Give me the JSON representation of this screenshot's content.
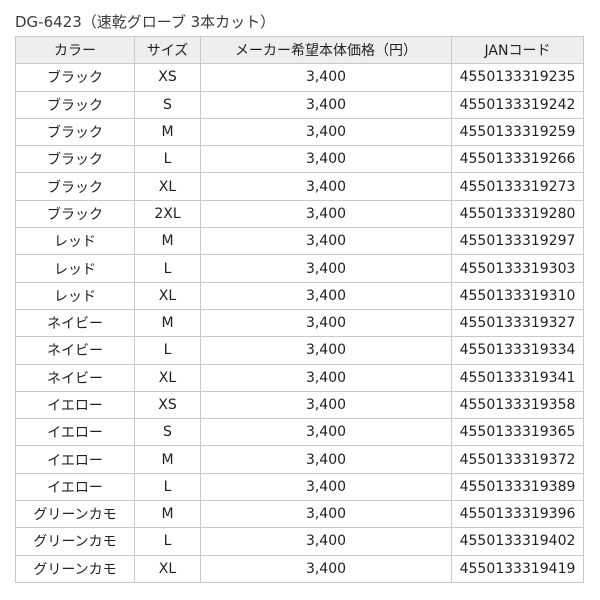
{
  "title": "DG-6423（速乾グローブ 3本カット）",
  "table": {
    "headers": [
      "カラー",
      "サイズ",
      "メーカー希望本体価格（円）",
      "JANコード"
    ],
    "rows": [
      [
        "ブラック",
        "XS",
        "3,400",
        "4550133319235"
      ],
      [
        "ブラック",
        "S",
        "3,400",
        "4550133319242"
      ],
      [
        "ブラック",
        "M",
        "3,400",
        "4550133319259"
      ],
      [
        "ブラック",
        "L",
        "3,400",
        "4550133319266"
      ],
      [
        "ブラック",
        "XL",
        "3,400",
        "4550133319273"
      ],
      [
        "ブラック",
        "2XL",
        "3,400",
        "4550133319280"
      ],
      [
        "レッド",
        "M",
        "3,400",
        "4550133319297"
      ],
      [
        "レッド",
        "L",
        "3,400",
        "4550133319303"
      ],
      [
        "レッド",
        "XL",
        "3,400",
        "4550133319310"
      ],
      [
        "ネイビー",
        "M",
        "3,400",
        "4550133319327"
      ],
      [
        "ネイビー",
        "L",
        "3,400",
        "4550133319334"
      ],
      [
        "ネイビー",
        "XL",
        "3,400",
        "4550133319341"
      ],
      [
        "イエロー",
        "XS",
        "3,400",
        "4550133319358"
      ],
      [
        "イエロー",
        "S",
        "3,400",
        "4550133319365"
      ],
      [
        "イエロー",
        "M",
        "3,400",
        "4550133319372"
      ],
      [
        "イエロー",
        "L",
        "3,400",
        "4550133319389"
      ],
      [
        "グリーンカモ",
        "M",
        "3,400",
        "4550133319396"
      ],
      [
        "グリーンカモ",
        "L",
        "3,400",
        "4550133319402"
      ],
      [
        "グリーンカモ",
        "XL",
        "3,400",
        "4550133319419"
      ]
    ]
  }
}
